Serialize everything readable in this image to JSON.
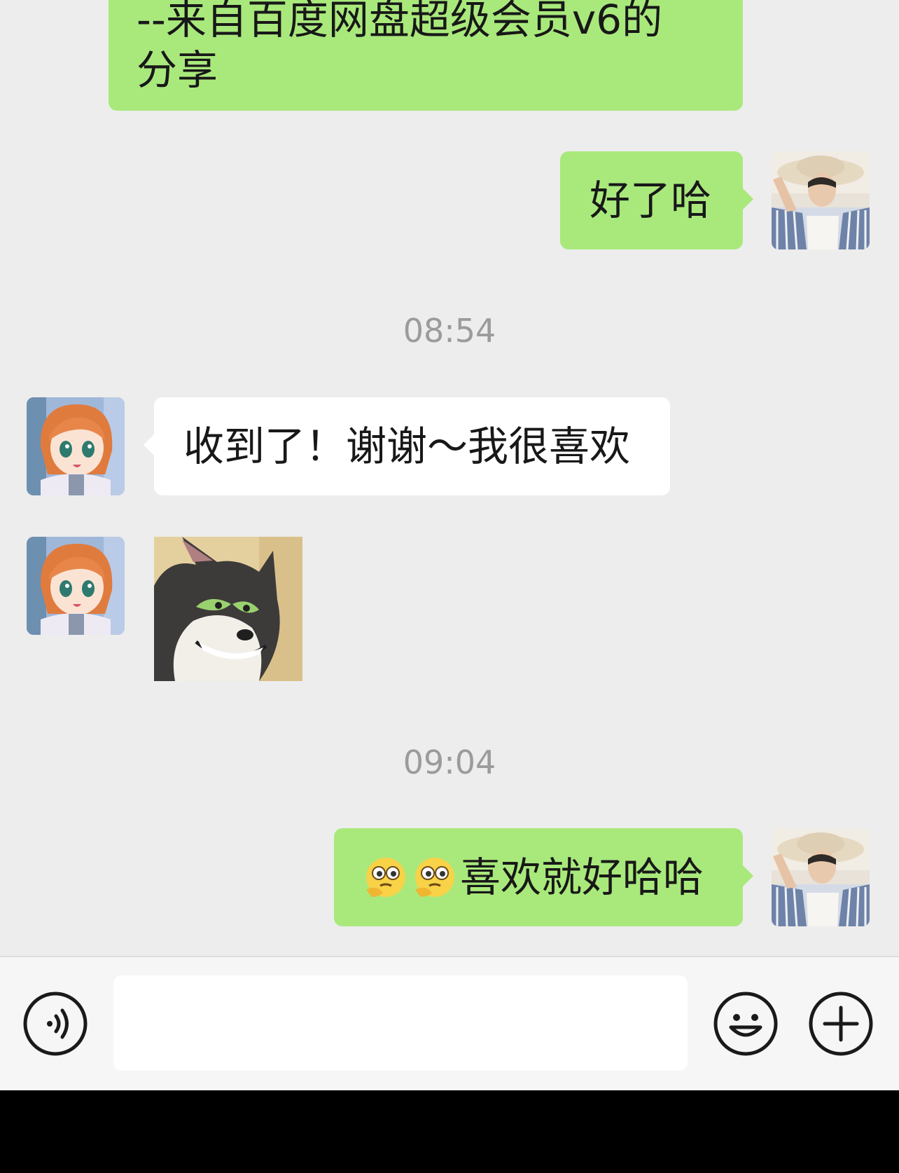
{
  "messages": [
    {
      "side": "out",
      "type": "text",
      "text": "--来自百度网盘超级会员v6的\n分享"
    },
    {
      "side": "out",
      "type": "text",
      "text": "好了哈"
    },
    {
      "type": "time",
      "text": "08:54"
    },
    {
      "side": "in",
      "type": "text",
      "text": "收到了！谢谢～我很喜欢"
    },
    {
      "side": "in",
      "type": "sticker",
      "sticker": "tom-cat-smirk-sticker"
    },
    {
      "type": "time",
      "text": "09:04"
    },
    {
      "side": "out",
      "type": "text",
      "emoji": [
        "thinking-face-emoji",
        "thinking-face-emoji"
      ],
      "text": "喜欢就好哈哈"
    }
  ],
  "avatars": {
    "self": "man-in-hat-avatar",
    "contact": "anime-girl-avatar"
  },
  "input_bar": {
    "voice_icon": "voice-icon",
    "input_value": "",
    "emoji_icon": "smiley-icon",
    "more_icon": "plus-icon"
  },
  "colors": {
    "background": "#ededed",
    "outgoing_bubble": "#a9e97c",
    "incoming_bubble": "#ffffff",
    "timestamp": "#9b9b9b"
  }
}
